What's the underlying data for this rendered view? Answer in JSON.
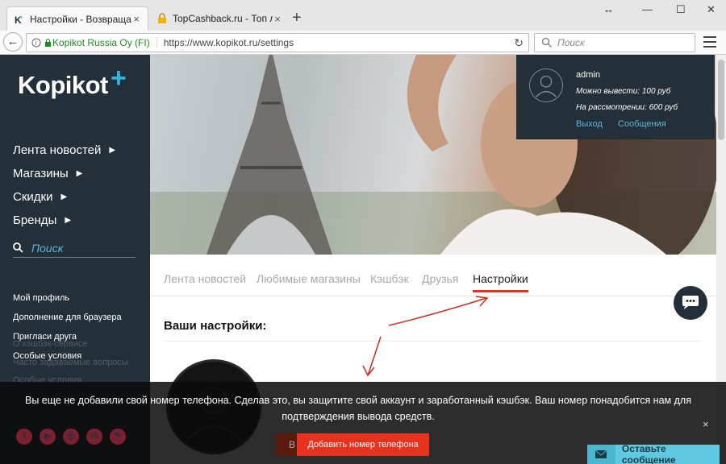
{
  "browser": {
    "tabs": [
      {
        "title": "Настройки - Возвращайт...",
        "close": "×"
      },
      {
        "title": "TopCashback.ru - Топ лу...",
        "close": "×"
      }
    ],
    "new_tab": "+",
    "window_controls": {
      "resize": "↔",
      "minimize": "—",
      "maximize": "☐",
      "close": "✕"
    },
    "address": {
      "site_identity": "Kopikot Russia Oy (FI)",
      "url": "https://www.kopikot.ru/settings"
    },
    "search_placeholder": "Поиск"
  },
  "sidebar": {
    "logo": "Kopikot",
    "logo_plus": "+",
    "nav": [
      "Лента новостей",
      "Магазины",
      "Скидки",
      "Бренды"
    ],
    "search_placeholder": "Поиск",
    "links": [
      "Мой профиль",
      "Дополнение для браузера",
      "Пригласи друга",
      "Особые условия"
    ],
    "faded_links": [
      "О кэшбэк-сервисе",
      "Часто задаваемые вопросы",
      "Особые условия"
    ],
    "social": [
      "f",
      "▶",
      "◎",
      "vk",
      "✎"
    ]
  },
  "user": {
    "name": "admin",
    "withdraw_label": "Можно вывести: ",
    "withdraw_value": "100 руб",
    "pending_label": "На рассмотрении: ",
    "pending_value": "600 руб",
    "logout": "Выход",
    "messages": "Сообщения"
  },
  "content": {
    "tabs": [
      "Лента новостей",
      "Любимые магазины",
      "Кэшбэк",
      "Друзья",
      "Настройки"
    ],
    "active_tab": "Настройки",
    "settings_title": "Ваши настройки:"
  },
  "overlay": {
    "message_line1": "Вы еще не добавили свой номер телефона. Сделав это, вы защитите свой аккаунт и заработанный кэшбэк. Ваш номер понадобится нам для",
    "message_line2": "подтверждения вывода средств.",
    "close": "×",
    "hidden_button": "В",
    "add_phone_button": "Добавить номер телефона"
  },
  "chat": {
    "leave_message": "Оставьте сообщение"
  },
  "colors": {
    "sidebar_bg": "#233039",
    "accent_blue": "#2fb6e0",
    "accent_red": "#e8321d",
    "chat_teal": "#5ec9e0"
  }
}
